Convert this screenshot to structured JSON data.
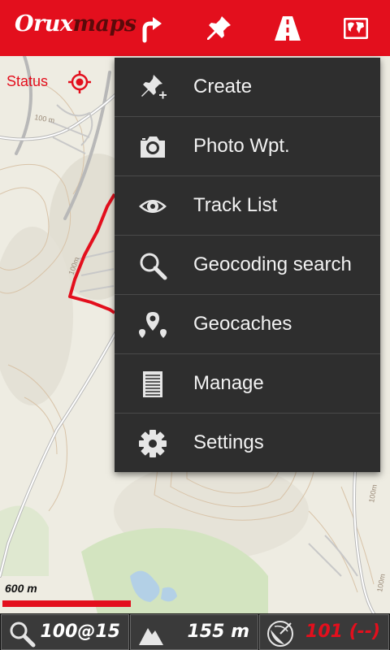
{
  "app": {
    "logo_part1": "Orux",
    "logo_part2": "maps"
  },
  "toolbar": {
    "buttons": [
      {
        "icon": "route-arrow-icon"
      },
      {
        "icon": "pushpin-icon"
      },
      {
        "icon": "road-icon"
      },
      {
        "icon": "world-map-icon"
      }
    ]
  },
  "map": {
    "status_label": "Status",
    "contour_labels": [
      "100 m",
      "100m",
      "100m",
      "100m"
    ]
  },
  "menu": {
    "items": [
      {
        "label": "Create",
        "icon": "pin-add-icon"
      },
      {
        "label": "Photo Wpt.",
        "icon": "camera-icon"
      },
      {
        "label": "Track List",
        "icon": "eye-icon"
      },
      {
        "label": "Geocoding search",
        "icon": "search-icon"
      },
      {
        "label": "Geocaches",
        "icon": "geocache-pins-icon"
      },
      {
        "label": "Manage",
        "icon": "list-document-icon"
      },
      {
        "label": "Settings",
        "icon": "gear-icon"
      }
    ]
  },
  "scale": {
    "label": "600 m"
  },
  "bottom": {
    "zoom": "100@15",
    "altitude": "155 m",
    "gps": "101 (--)"
  },
  "colors": {
    "accent": "#e30f1d",
    "menu_bg": "#2e2e2e",
    "track": "#e30f1d"
  }
}
